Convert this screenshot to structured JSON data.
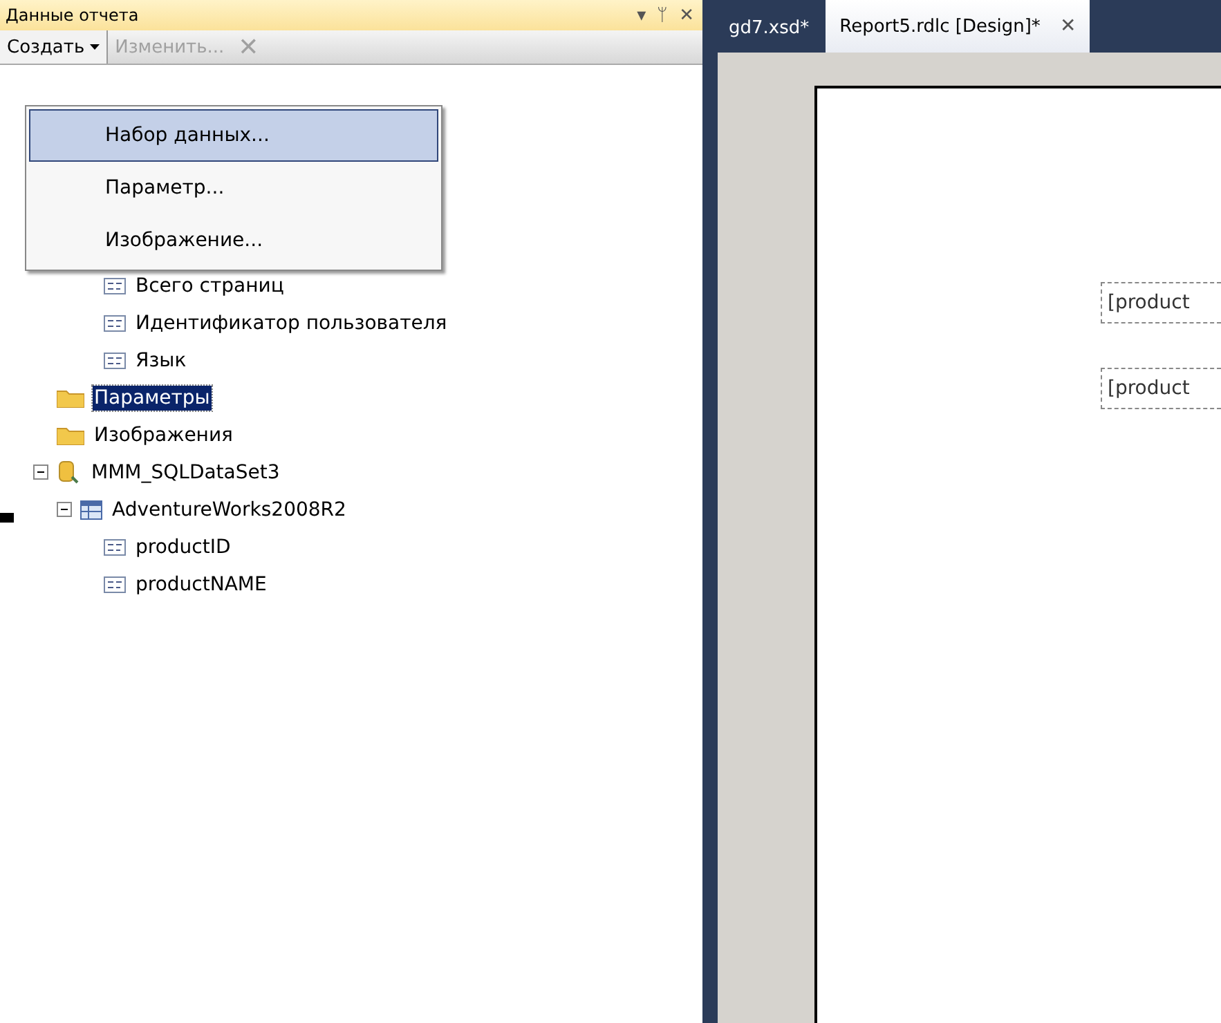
{
  "panel": {
    "title": "Данные отчета",
    "title_buttons": [
      "▾",
      "ᛘ",
      "✕"
    ]
  },
  "toolbar": [
    {
      "label": "Создать",
      "kind": "dropdown",
      "disabled": false
    },
    {
      "label": "Изменить...",
      "kind": "button",
      "disabled": true
    },
    {
      "label": "✕",
      "kind": "icon",
      "disabled": true
    }
  ],
  "menu": [
    {
      "label": "Набор данных...",
      "selected": true
    },
    {
      "label": "Параметр...",
      "selected": false
    },
    {
      "label": "Изображение...",
      "selected": false
    }
  ],
  "tree": [
    {
      "kind": "group",
      "children": [
        {
          "kind": "field",
          "label": "Всего страниц",
          "selected": false
        },
        {
          "kind": "field",
          "label": "Идентификатор пользователя",
          "selected": false
        },
        {
          "kind": "field",
          "label": "Язык",
          "selected": false
        }
      ]
    },
    {
      "kind": "folder",
      "label": "Параметры",
      "selected": true
    },
    {
      "kind": "folder",
      "label": "Изображения",
      "selected": false
    },
    {
      "kind": "dataset",
      "label": "MMM_SQLDataSet3",
      "expanded": true,
      "selected": false,
      "children": [
        {
          "kind": "table",
          "label": "AdventureWorks2008R2",
          "expanded": true,
          "selected": false,
          "children": [
            {
              "kind": "field",
              "label": "productID",
              "selected": false
            },
            {
              "kind": "field",
              "label": "productNAME",
              "selected": false
            }
          ]
        }
      ]
    }
  ],
  "tabs": [
    {
      "label": "gd7.xsd*",
      "selected": false
    },
    {
      "label": "Report5.rdlc [Design]*",
      "selected": true,
      "close": "✕"
    }
  ],
  "report_fields": [
    "[product",
    "[product"
  ]
}
